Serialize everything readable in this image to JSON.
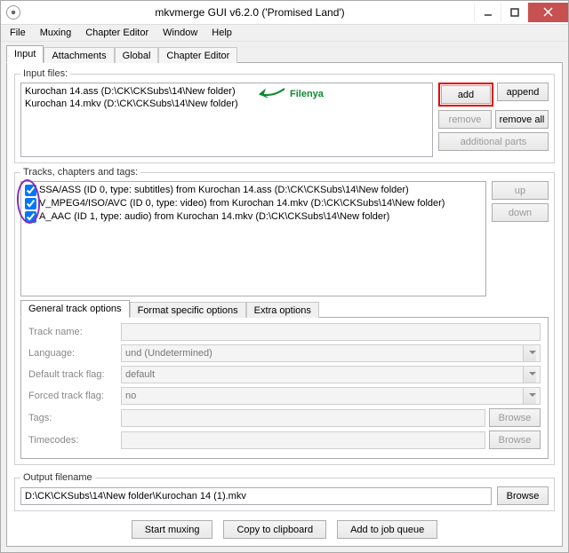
{
  "title": "mkvmerge GUI v6.2.0 ('Promised Land')",
  "menu": {
    "file": "File",
    "muxing": "Muxing",
    "chapter_editor": "Chapter Editor",
    "window": "Window",
    "help": "Help"
  },
  "tabs": {
    "input": "Input",
    "attachments": "Attachments",
    "global": "Global",
    "chapter_editor": "Chapter Editor"
  },
  "input_files": {
    "legend": "Input files:",
    "items": [
      "Kurochan 14.ass (D:\\CK\\CKSubs\\14\\New folder)",
      "Kurochan 14.mkv (D:\\CK\\CKSubs\\14\\New folder)"
    ],
    "annotation": "Filenya",
    "buttons": {
      "add": "add",
      "append": "append",
      "remove": "remove",
      "remove_all": "remove all",
      "additional": "additional parts"
    }
  },
  "tracks_section": {
    "legend": "Tracks, chapters and tags:",
    "items": [
      "SSA/ASS (ID 0, type: subtitles) from Kurochan 14.ass (D:\\CK\\CKSubs\\14\\New folder)",
      "V_MPEG4/ISO/AVC (ID 0, type: video) from Kurochan 14.mkv (D:\\CK\\CKSubs\\14\\New folder)",
      "A_AAC (ID 1, type: audio) from Kurochan 14.mkv (D:\\CK\\CKSubs\\14\\New folder)"
    ],
    "buttons": {
      "up": "up",
      "down": "down"
    }
  },
  "subtabs": {
    "general": "General track options",
    "format": "Format specific options",
    "extra": "Extra options"
  },
  "trackopts": {
    "track_name": {
      "label": "Track name:",
      "value": ""
    },
    "language": {
      "label": "Language:",
      "value": "und (Undetermined)"
    },
    "default_flag": {
      "label": "Default track flag:",
      "value": "default"
    },
    "forced_flag": {
      "label": "Forced track flag:",
      "value": "no"
    },
    "tags": {
      "label": "Tags:",
      "value": "",
      "browse": "Browse"
    },
    "timecodes": {
      "label": "Timecodes:",
      "value": "",
      "browse": "Browse"
    }
  },
  "output": {
    "legend": "Output filename",
    "value": "D:\\CK\\CKSubs\\14\\New folder\\Kurochan 14 (1).mkv",
    "browse": "Browse"
  },
  "actions": {
    "start": "Start muxing",
    "copy": "Copy to clipboard",
    "queue": "Add to job queue"
  }
}
